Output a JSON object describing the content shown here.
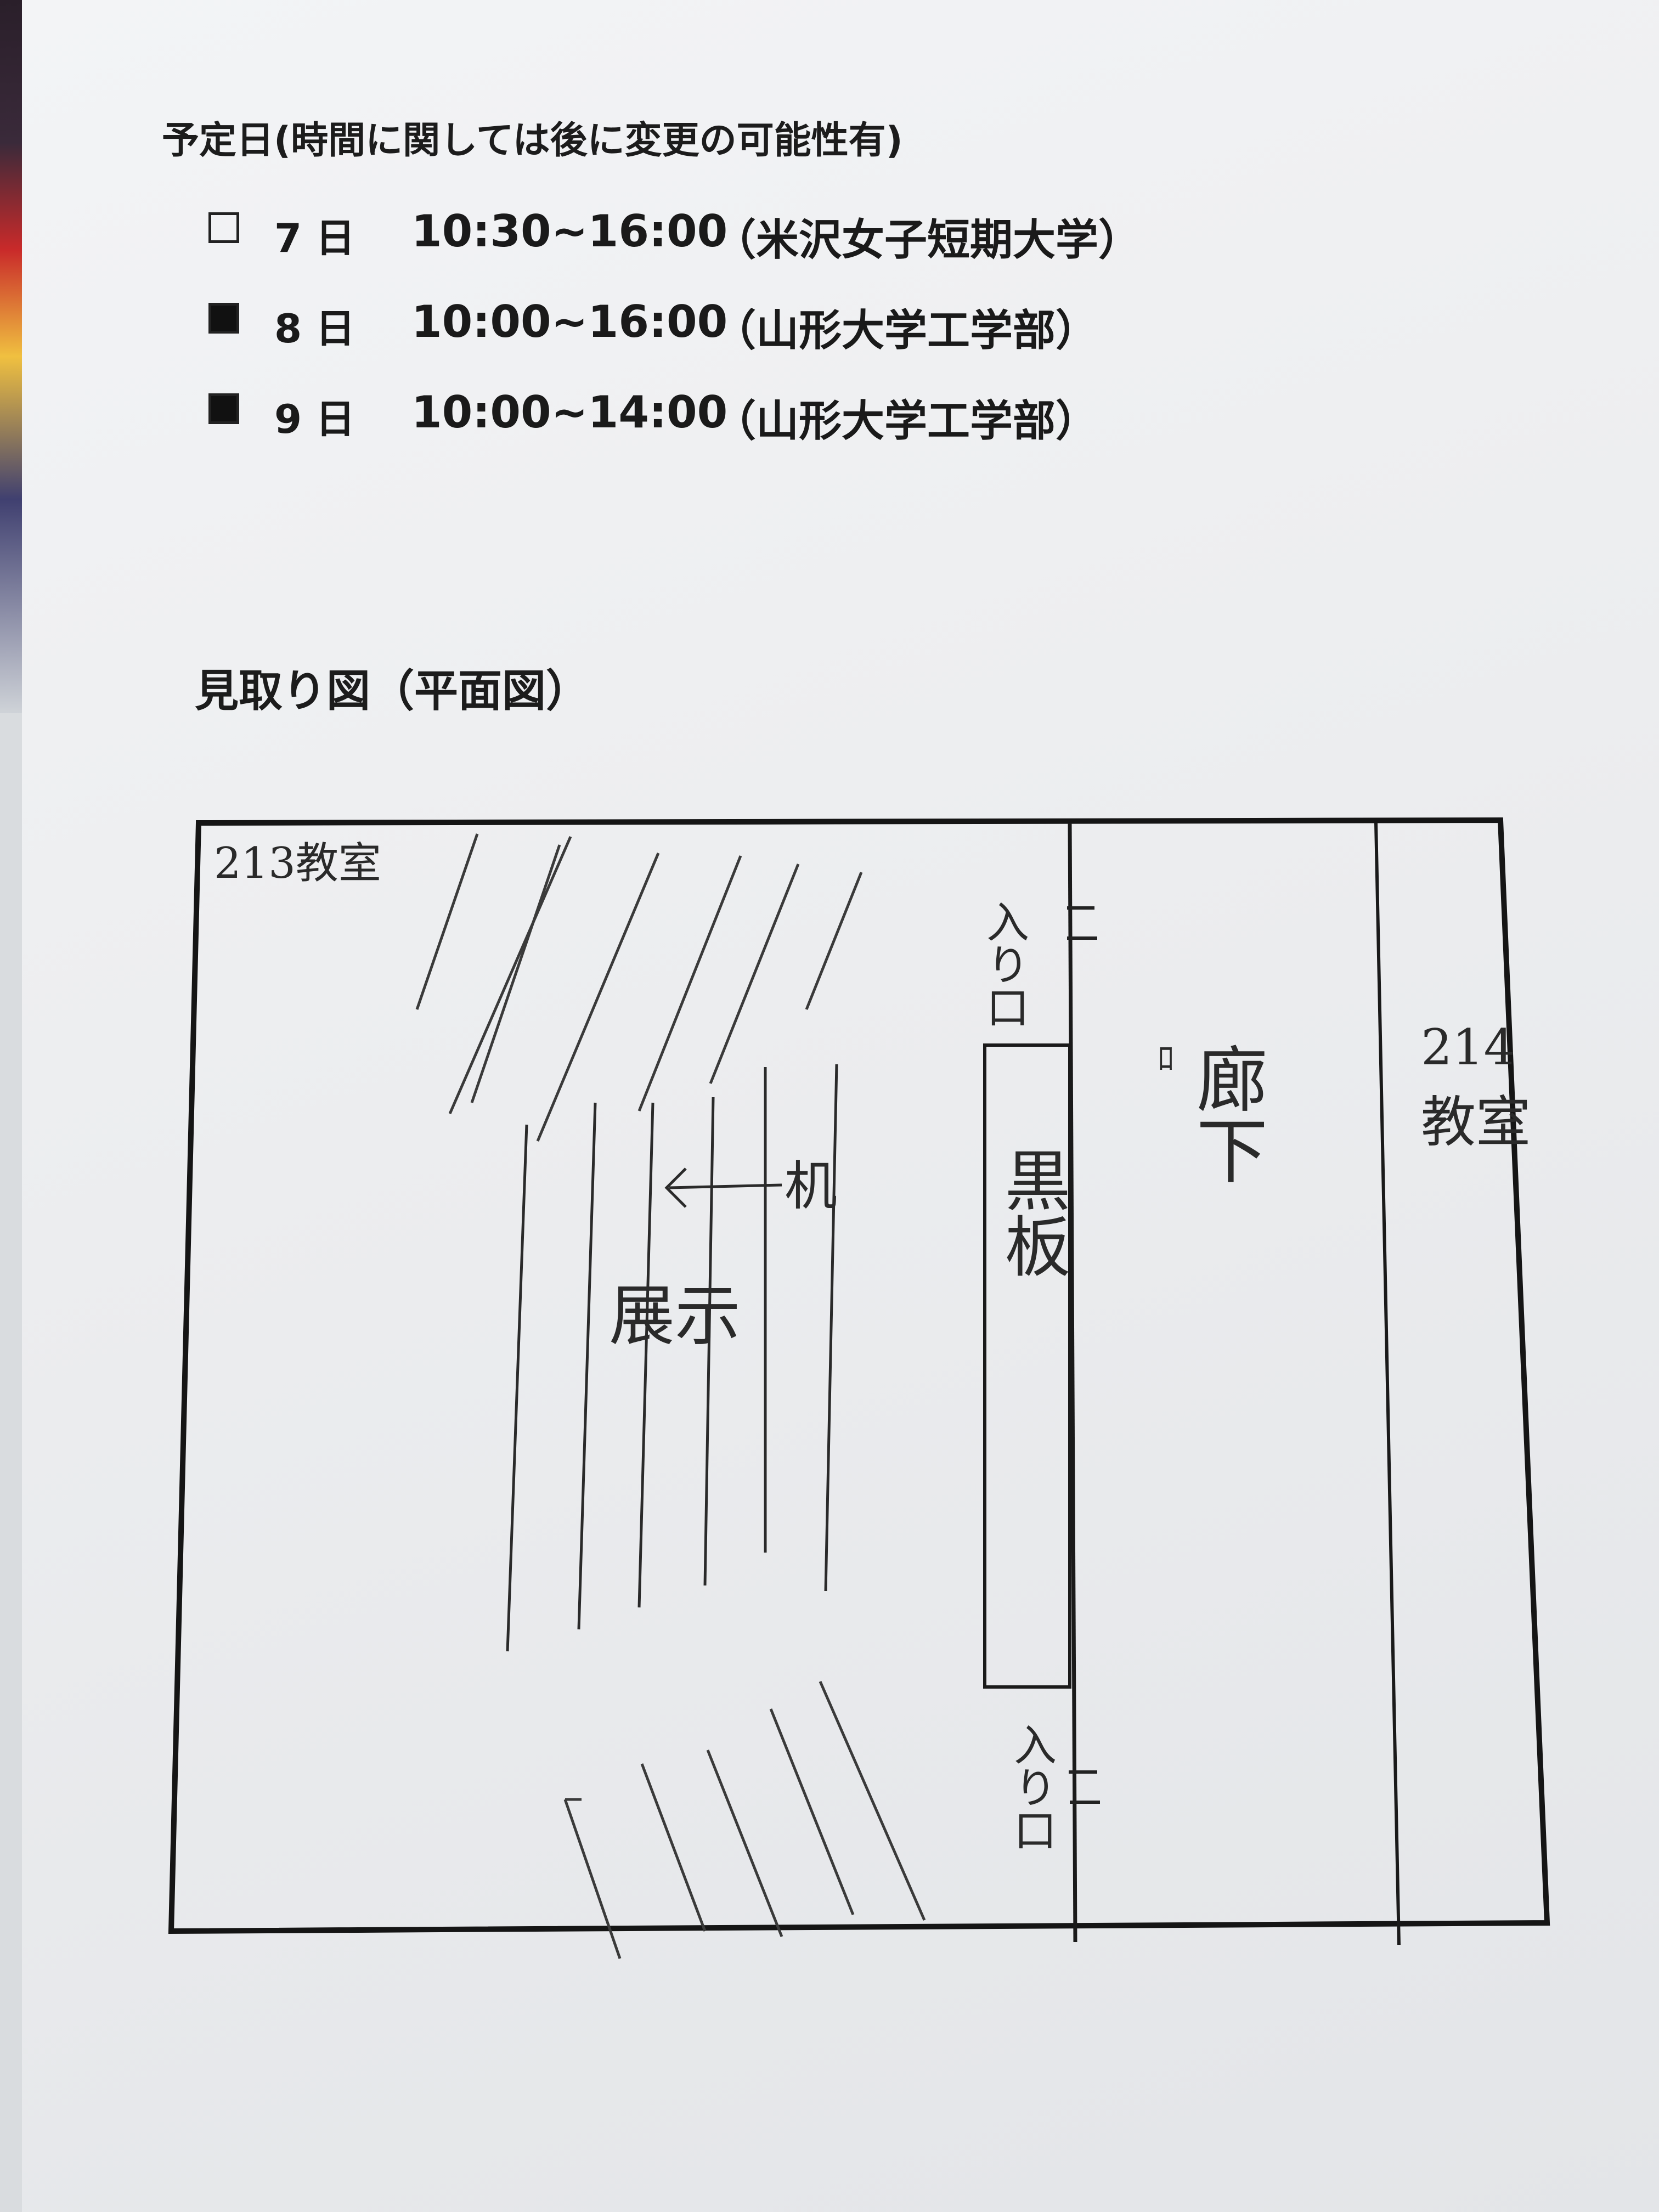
{
  "schedule": {
    "heading": "予定日(時間に関しては後に変更の可能性有)",
    "rows": [
      {
        "checked": false,
        "day": "7 日",
        "time": "10:30~16:00",
        "venue": "（米沢女子短期大学）"
      },
      {
        "checked": true,
        "day": "8 日",
        "time": "10:00~16:00",
        "venue": "（山形大学工学部）"
      },
      {
        "checked": true,
        "day": "9 日",
        "time": "10:00~14:00",
        "venue": "（山形大学工学部）"
      }
    ]
  },
  "floorplan": {
    "title": "見取り図（平面図）",
    "room_left": "213教室",
    "room_right": "214教室",
    "entrance_top": "入り口",
    "entrance_bottom": "入り口",
    "blackboard": "黒板",
    "corridor": "廊下",
    "desk_label": "机",
    "exhibit_label": "展示"
  }
}
